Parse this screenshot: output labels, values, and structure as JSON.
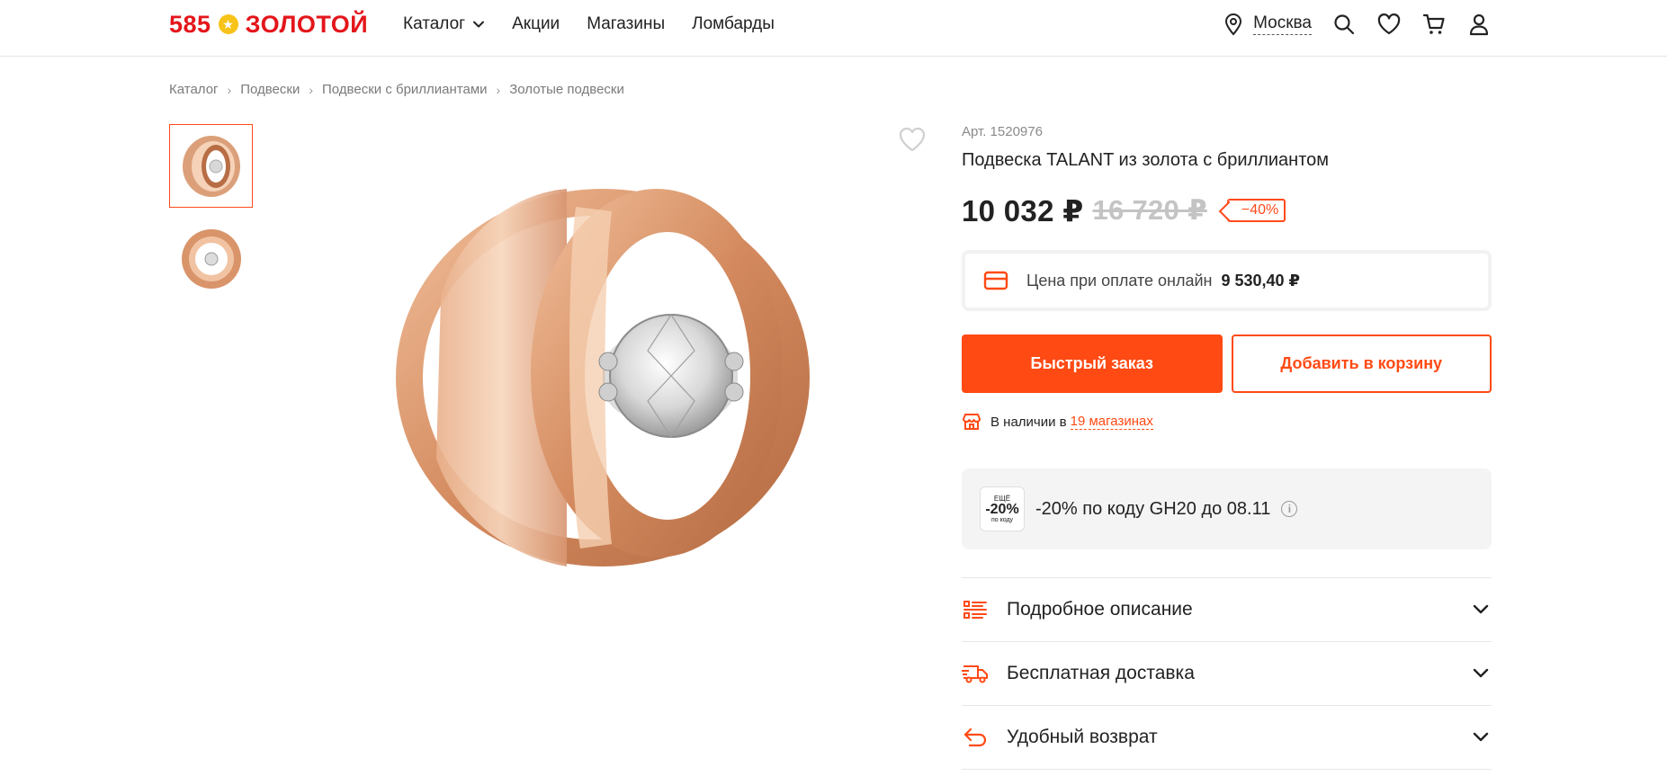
{
  "header": {
    "logo_number": "585",
    "logo_word": "ЗОЛОТОЙ",
    "nav": [
      {
        "label": "Каталог",
        "icon": "chevron-down-icon"
      },
      {
        "label": "Акции"
      },
      {
        "label": "Магазины"
      },
      {
        "label": "Ломбарды"
      }
    ],
    "city": "Москва",
    "icons": [
      "location-pin-icon",
      "search-icon",
      "heart-icon",
      "cart-icon",
      "user-icon"
    ]
  },
  "breadcrumb": [
    "Каталог",
    "Подвески",
    "Подвески с бриллиантами",
    "Золотые подвески"
  ],
  "product": {
    "article": "Арт. 1520976",
    "title": "Подвеска TALANT из золота с бриллиантом",
    "price": "10 032 ₽",
    "old_price": "16 720 ₽",
    "discount": "−40%",
    "online_label": "Цена при оплате онлайн",
    "online_price": "9 530,40 ₽",
    "quick_order": "Быстрый заказ",
    "add_to_cart": "Добавить в корзину",
    "stock_prefix": "В наличии в",
    "stock_link": "19 магазинах",
    "promo": {
      "badge_top": "ЕЩЁ",
      "badge_main": "-20%",
      "badge_bottom": "по коду",
      "text": "-20% по коду GH20 до 08.11"
    },
    "accordion": [
      {
        "label": "Подробное описание",
        "icon": "list-icon"
      },
      {
        "label": "Бесплатная доставка",
        "icon": "truck-icon"
      },
      {
        "label": "Удобный возврат",
        "icon": "return-arrow-icon"
      }
    ]
  },
  "colors": {
    "brand_red": "#e3161b",
    "accent_orange": "#ff4a14",
    "gold": "#d9946a"
  }
}
